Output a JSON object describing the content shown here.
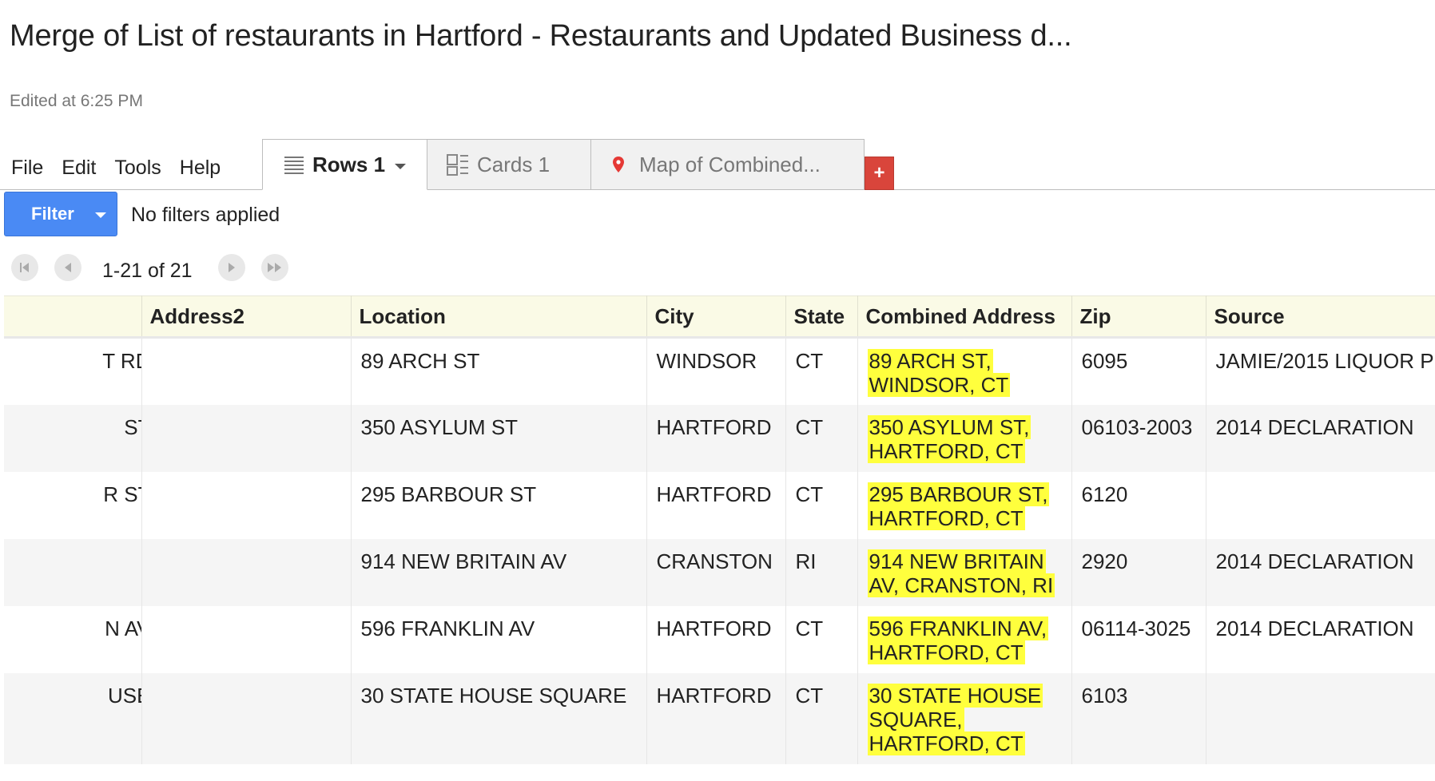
{
  "doc": {
    "title": "Merge of List of restaurants in Hartford - Restaurants and Updated Business d...",
    "edited": "Edited at 6:25 PM"
  },
  "menu": [
    "File",
    "Edit",
    "Tools",
    "Help"
  ],
  "tabs": {
    "rows": {
      "label": "Rows 1",
      "icon": "list-rows-icon"
    },
    "cards": {
      "label": "Cards 1",
      "icon": "cards-icon"
    },
    "map": {
      "label": "Map of Combined...",
      "icon": "map-pin-icon"
    },
    "add": "+"
  },
  "filter": {
    "button_label": "Filter",
    "status": "No filters applied"
  },
  "pager": {
    "range": "1-21 of 21"
  },
  "table": {
    "columns": [
      "",
      "Address2",
      "Location",
      "City",
      "State",
      "Combined Address",
      "Zip",
      "Source"
    ],
    "rows": [
      {
        "address": "T RD",
        "address2": "",
        "location": "89 ARCH ST",
        "city": "WINDSOR",
        "state": "CT",
        "combined": "89 ARCH ST, WINDSOR, CT",
        "zip": "6095",
        "source": "JAMIE/2015 LIQUOR P"
      },
      {
        "address": "ST",
        "address2": "",
        "location": "350 ASYLUM ST",
        "city": "HARTFORD",
        "state": "CT",
        "combined": "350 ASYLUM ST, HARTFORD, CT",
        "zip": "06103-2003",
        "source": "2014 DECLARATION"
      },
      {
        "address": "R ST",
        "address2": "",
        "location": "295 BARBOUR ST",
        "city": "HARTFORD",
        "state": "CT",
        "combined": "295 BARBOUR ST, HARTFORD, CT",
        "zip": "6120",
        "source": ""
      },
      {
        "address": "",
        "address2": "",
        "location": "914 NEW BRITAIN AV",
        "city": "CRANSTON",
        "state": "RI",
        "combined": "914 NEW BRITAIN AV, CRANSTON, RI",
        "zip": "2920",
        "source": "2014 DECLARATION"
      },
      {
        "address": "N AV",
        "address2": "",
        "location": "596 FRANKLIN AV",
        "city": "HARTFORD",
        "state": "CT",
        "combined": "596 FRANKLIN AV, HARTFORD, CT",
        "zip": "06114-3025",
        "source": "2014 DECLARATION"
      },
      {
        "address": "USE",
        "address2": "",
        "location": "30 STATE HOUSE SQUARE",
        "city": "HARTFORD",
        "state": "CT",
        "combined": "30 STATE HOUSE SQUARE, HARTFORD, CT",
        "zip": "6103",
        "source": ""
      }
    ]
  },
  "colors": {
    "accent": "#4a8af4",
    "add_tab": "#d9453b",
    "highlight": "#ffff3d",
    "header_bg": "#fafae6"
  }
}
